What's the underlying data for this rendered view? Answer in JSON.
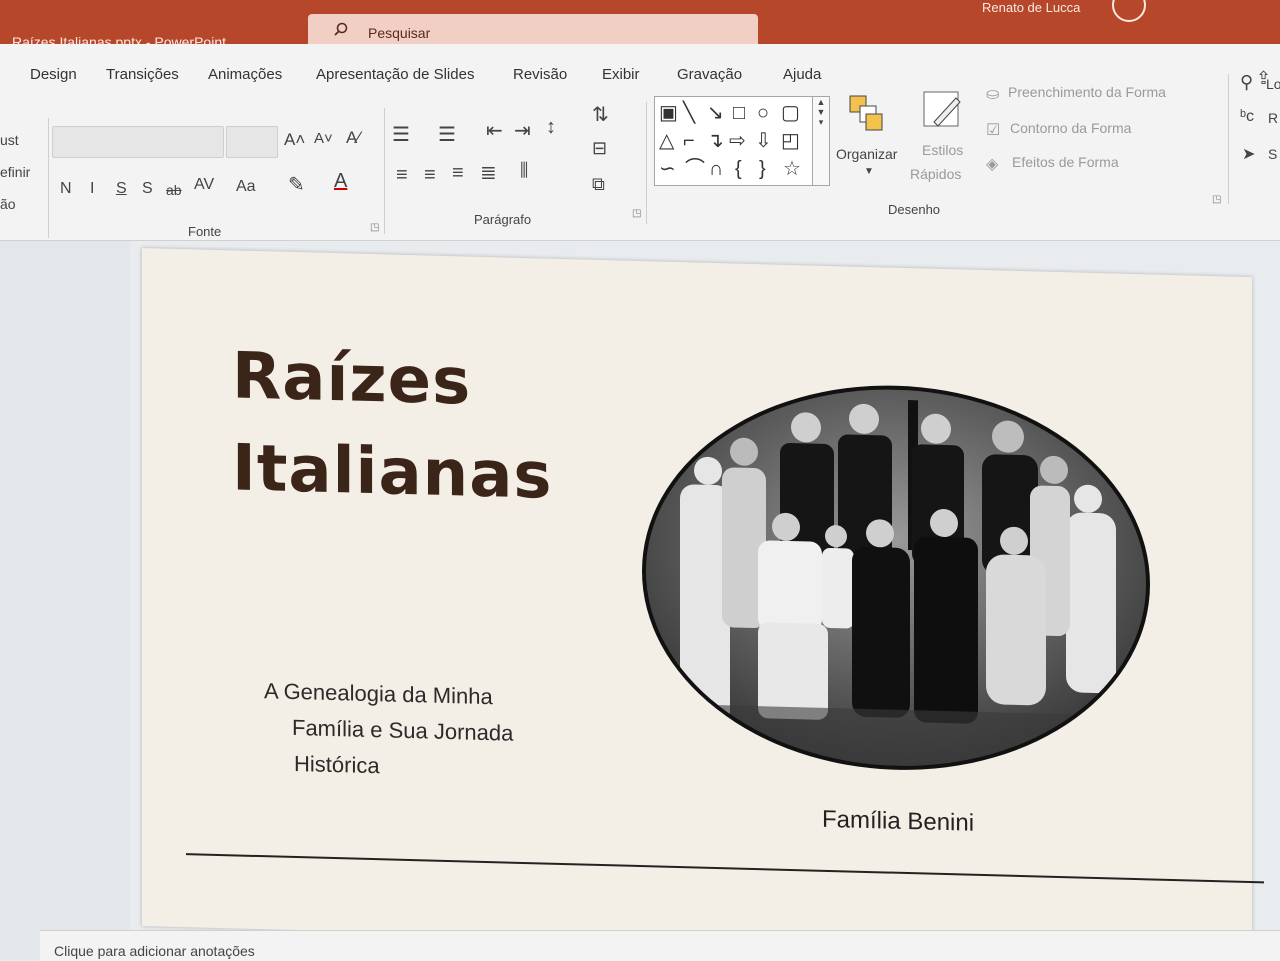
{
  "window": {
    "file_title": "Raízes Italianas.pptx  -  PowerPoint",
    "search_placeholder": "Pesquisar",
    "user_name": "Renato de Lucca"
  },
  "ribbon": {
    "tabs": [
      "Design",
      "Transições",
      "Animações",
      "Apresentação de Slides",
      "Revisão",
      "Exibir",
      "Gravação",
      "Ajuda"
    ],
    "left_clipped": [
      "ust",
      "efinir",
      "ão"
    ],
    "font": {
      "grow": "A˄",
      "shrink": "A˅",
      "clear": "A⁄",
      "bold": "N",
      "italic": "I",
      "underline": "S",
      "shadow": "S",
      "strike": "ab",
      "spacing": "AV",
      "case": "Aa",
      "group_label": "Fonte"
    },
    "paragraph": {
      "group_label": "Parágrafo"
    },
    "drawing": {
      "arrange": "Organizar",
      "quick_styles": [
        "Estilos",
        "Rápidos"
      ],
      "fill": "Preenchimento da Forma",
      "outline": "Contorno da Forma",
      "effects": "Efeitos de Forma",
      "group_label": "Desenho"
    },
    "editing_clipped": [
      "Lo",
      "R",
      "S"
    ]
  },
  "slide": {
    "title_lines": [
      "Raízes",
      "Italianas"
    ],
    "subtitle_lines": [
      "A Genealogia da Minha",
      "Família e Sua Jornada",
      "Histórica"
    ],
    "caption": "Família Benini"
  },
  "notes_placeholder": "Clique para adicionar anotações"
}
